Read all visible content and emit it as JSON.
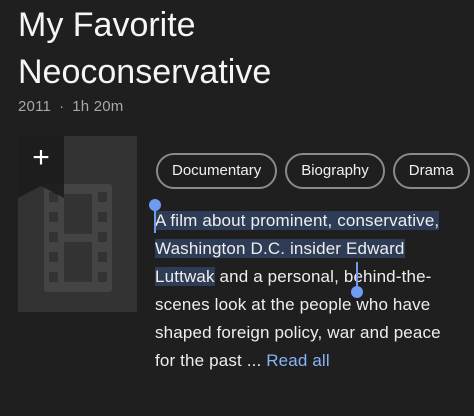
{
  "title": "My Favorite Neoconservative",
  "meta": {
    "year": "2011",
    "separator": "·",
    "duration": "1h 20m"
  },
  "poster": {
    "add_label": "+",
    "placeholder_icon": "film-strip-icon",
    "add_icon": "bookmark-plus-icon"
  },
  "genres": [
    "Documentary",
    "Biography",
    "Drama"
  ],
  "plot": {
    "selected_text": "A film about prominent, conservative, Washington D.C. insider Edward Luttwak",
    "rest_text": " and a personal, behind-the-scenes look at the people who have shaped foreign policy, war and peace for the past ... ",
    "read_all_label": "Read all"
  },
  "colors": {
    "background": "#1f1f1f",
    "accent": "#8ab4f8",
    "selection_handle": "#6f9cf0",
    "selection_highlight": "#2e3d55"
  }
}
